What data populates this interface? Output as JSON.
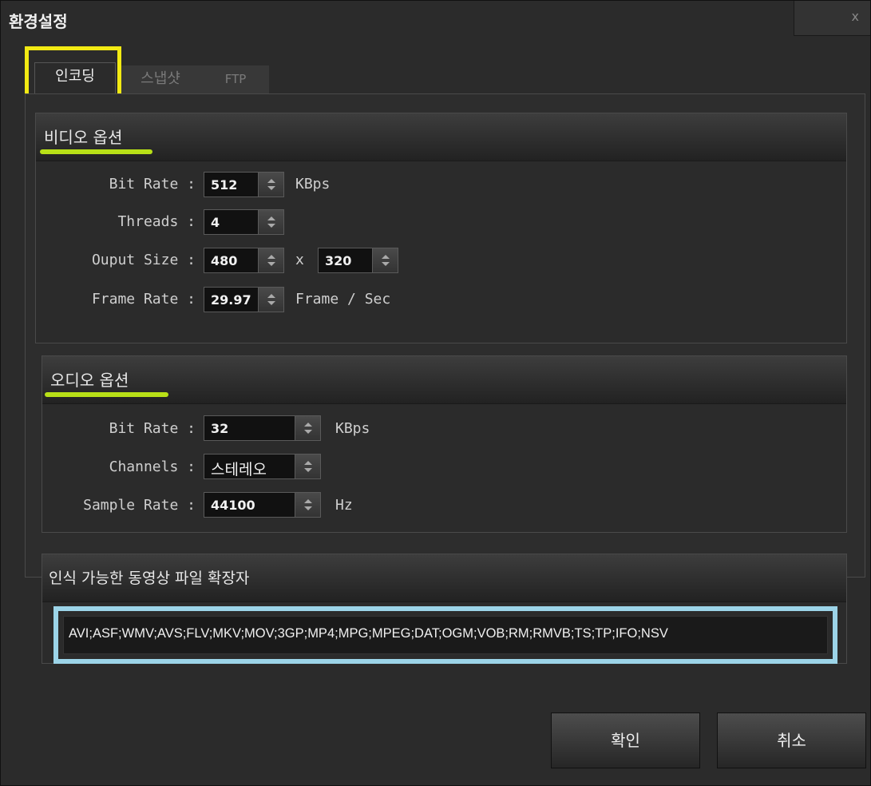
{
  "window": {
    "title": "환경설정",
    "close_label": "x"
  },
  "tabs": [
    {
      "label": "인코딩",
      "active": true
    },
    {
      "label": "스냅샷",
      "active": false
    },
    {
      "label": "FTP",
      "active": false
    }
  ],
  "video_options": {
    "title": "비디오 옵션",
    "bit_rate": {
      "label": "Bit Rate :",
      "value": "512",
      "unit": "KBps"
    },
    "threads": {
      "label": "Threads :",
      "value": "4"
    },
    "output_size": {
      "label": "Ouput Size :",
      "width": "480",
      "separator": "x",
      "height": "320"
    },
    "frame_rate": {
      "label": "Frame Rate :",
      "value": "29.97",
      "unit": "Frame / Sec"
    }
  },
  "audio_options": {
    "title": "오디오 옵션",
    "bit_rate": {
      "label": "Bit Rate :",
      "value": "32",
      "unit": "KBps"
    },
    "channels": {
      "label": "Channels :",
      "value": "스테레오"
    },
    "sample_rate": {
      "label": "Sample Rate :",
      "value": "44100",
      "unit": "Hz"
    }
  },
  "extensions": {
    "title": "인식 가능한 동영상 파일 확장자",
    "value": "AVI;ASF;WMV;AVS;FLV;MKV;MOV;3GP;MP4;MPG;MPEG;DAT;OGM;VOB;RM;RMVB;TS;TP;IFO;NSV"
  },
  "buttons": {
    "ok": "확인",
    "cancel": "취소"
  },
  "colors": {
    "tab_highlight": "#f2ea13",
    "section_underline": "#b8e017",
    "extension_highlight": "#9cd4e8"
  }
}
